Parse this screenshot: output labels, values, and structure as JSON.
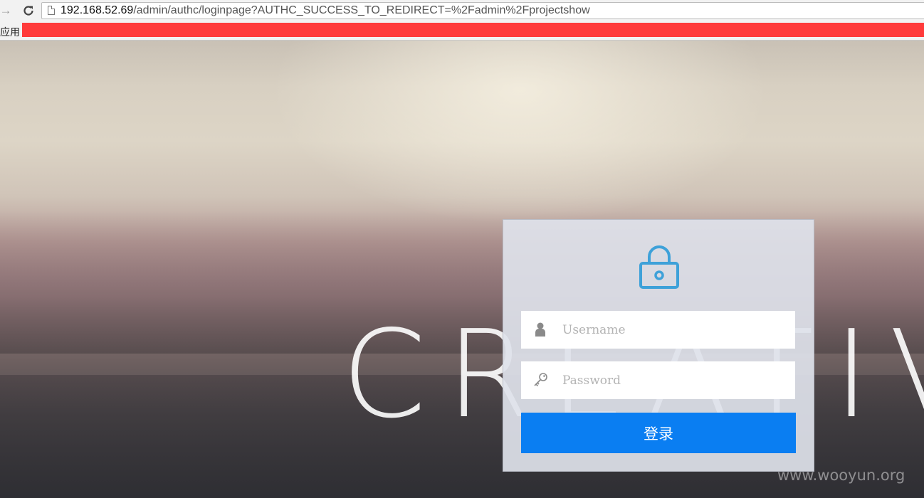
{
  "browser": {
    "url_host": "192.168.52.69",
    "url_path": "/admin/authc/loginpage?AUTHC_SUCCESS_TO_REDIRECT=%2Fadmin%2Fprojectshow",
    "bookmarks_label": "应用",
    "forward_icon": "arrow-right-icon",
    "reload_icon": "reload-icon"
  },
  "background": {
    "word": "CREATIVE"
  },
  "login": {
    "username_placeholder": "Username",
    "password_placeholder": "Password",
    "submit_label": "登录",
    "accent_color": "#3ea1d9",
    "button_color": "#0a7ef2"
  },
  "watermark": "www.wooyun.org"
}
